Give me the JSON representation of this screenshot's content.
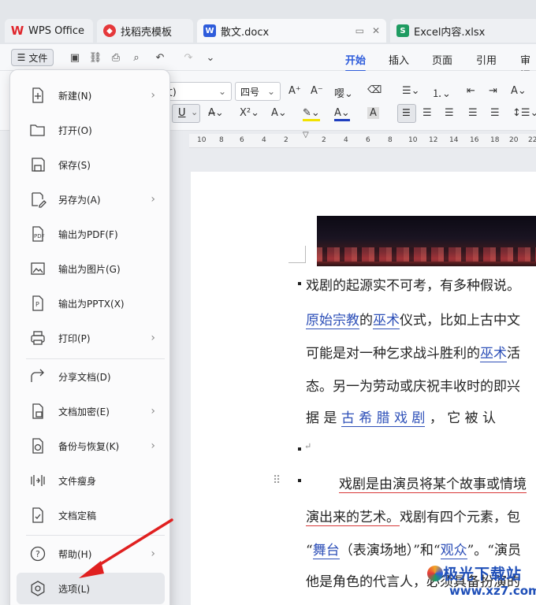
{
  "tabs": [
    {
      "label": "WPS Office",
      "icon": "wps-logo-icon"
    },
    {
      "label": "找稻壳模板",
      "icon": "docer-icon"
    },
    {
      "label": "散文.docx",
      "icon": "word-doc-icon"
    },
    {
      "label": "Excel内容.xlsx",
      "icon": "excel-sheet-icon"
    }
  ],
  "toolbar": {
    "file_label": "文件",
    "ribbon_tabs": [
      "开始",
      "插入",
      "页面",
      "引用",
      "审阅"
    ]
  },
  "ribbon": {
    "font_name": "文)",
    "font_size": "四号"
  },
  "ruler": {
    "ticks": [
      "10",
      "8",
      "6",
      "4",
      "2",
      "2",
      "4",
      "6",
      "8",
      "10",
      "12",
      "14",
      "16",
      "18",
      "20",
      "22"
    ]
  },
  "menu": {
    "items": [
      {
        "label": "新建(N)",
        "icon": "new-doc-icon",
        "submenu": true
      },
      {
        "label": "打开(O)",
        "icon": "folder-open-icon",
        "submenu": false
      },
      {
        "label": "保存(S)",
        "icon": "save-icon",
        "submenu": false
      },
      {
        "label": "另存为(A)",
        "icon": "save-as-icon",
        "submenu": true
      },
      {
        "label": "输出为PDF(F)",
        "icon": "export-pdf-icon",
        "submenu": false
      },
      {
        "label": "输出为图片(G)",
        "icon": "export-image-icon",
        "submenu": false
      },
      {
        "label": "输出为PPTX(X)",
        "icon": "export-pptx-icon",
        "submenu": false
      },
      {
        "label": "打印(P)",
        "icon": "print-icon",
        "submenu": true
      },
      {
        "label": "分享文档(D)",
        "icon": "share-icon",
        "submenu": false
      },
      {
        "label": "文档加密(E)",
        "icon": "encrypt-icon",
        "submenu": true
      },
      {
        "label": "备份与恢复(K)",
        "icon": "backup-icon",
        "submenu": true
      },
      {
        "label": "文件瘦身",
        "icon": "slim-file-icon",
        "submenu": false
      },
      {
        "label": "文档定稿",
        "icon": "finalize-icon",
        "submenu": false
      },
      {
        "label": "帮助(H)",
        "icon": "help-icon",
        "submenu": true
      },
      {
        "label": "选项(L)",
        "icon": "options-gear-icon",
        "submenu": false
      }
    ]
  },
  "document": {
    "lines": [
      {
        "parts": [
          {
            "t": "戏剧的起源实不可考，有多种假说。"
          }
        ]
      },
      {
        "parts": [
          {
            "t": "原始宗教",
            "link": true
          },
          {
            "t": "的"
          },
          {
            "t": "巫术",
            "link": true
          },
          {
            "t": "仪式，比如上古中文"
          }
        ]
      },
      {
        "parts": [
          {
            "t": "可能是对一种乞求战斗胜利的"
          },
          {
            "t": "巫术",
            "link": true
          },
          {
            "t": "活"
          }
        ]
      },
      {
        "parts": [
          {
            "t": "态。另一为劳动或庆祝丰收时的即兴"
          }
        ]
      },
      {
        "parts": [
          {
            "t": "据 是 "
          },
          {
            "t": "古 希 腊 戏 剧",
            "link": true
          },
          {
            "t": " ， 它 被 认"
          }
        ]
      },
      {
        "parts": [
          {
            "t": "↵"
          }
        ]
      },
      {
        "parts": [
          {
            "t": "戏剧是由演员将某个故事或情境",
            "red": true
          }
        ]
      },
      {
        "parts": [
          {
            "t": "演出来的艺术。",
            "red": true
          },
          {
            "t": "戏剧有四个元素，包"
          }
        ]
      },
      {
        "parts": [
          {
            "t": "“"
          },
          {
            "t": "舞台",
            "link": true
          },
          {
            "t": "（表演场地）”和“"
          },
          {
            "t": "观众",
            "link": true
          },
          {
            "t": "”。“演员"
          }
        ]
      },
      {
        "parts": [
          {
            "t": "他是角色的代言人，必须具备扮演的"
          }
        ]
      }
    ]
  },
  "watermark": {
    "title": "极光下载站",
    "url": "www.xz7.com"
  }
}
